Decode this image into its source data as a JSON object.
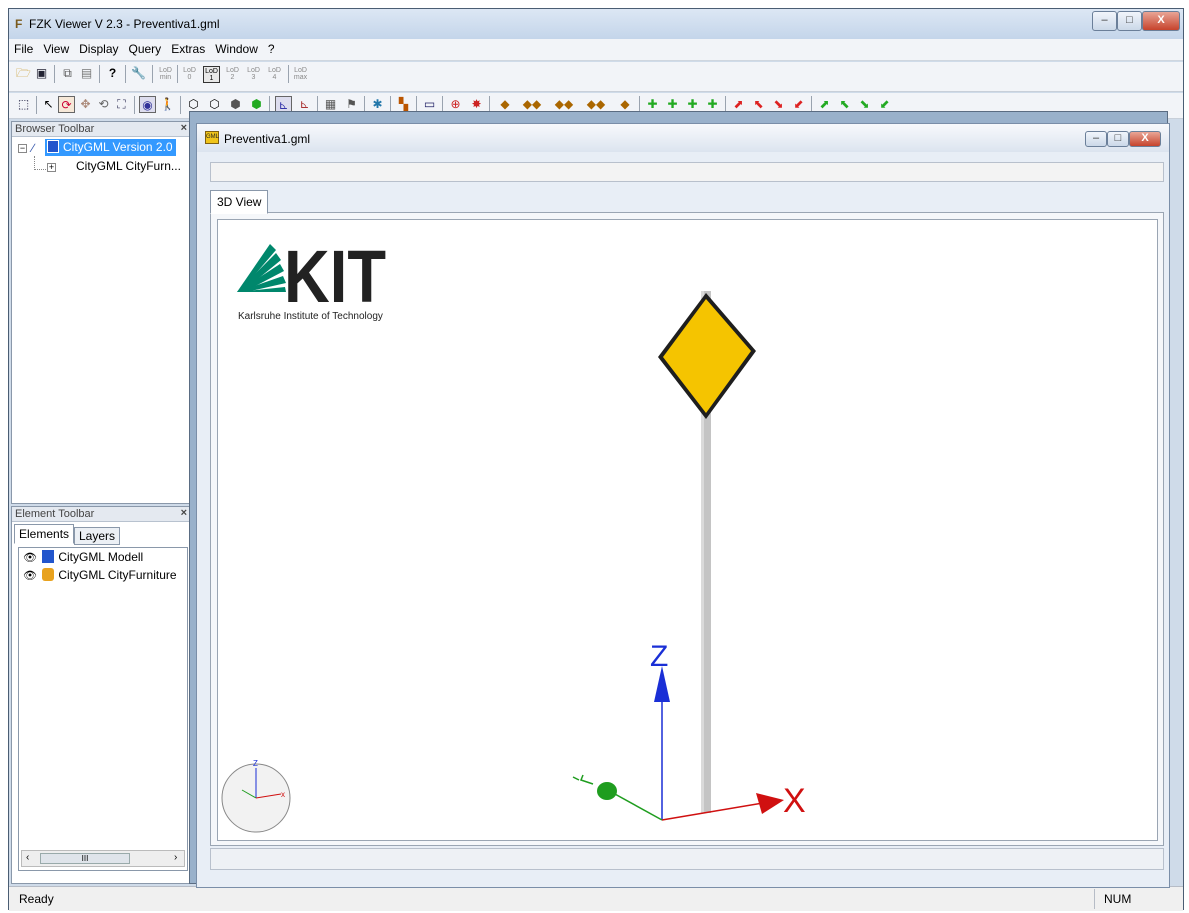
{
  "window": {
    "title": "FZK Viewer V 2.3 - Preventiva1.gml",
    "app_icon": "F"
  },
  "caption_buttons": {
    "minimize": "–",
    "maximize": "□",
    "close": "X"
  },
  "menu": [
    "File",
    "View",
    "Display",
    "Query",
    "Extras",
    "Window",
    "?"
  ],
  "lod_buttons": [
    {
      "top": "LoD",
      "bottom": "min"
    },
    {
      "top": "LoD",
      "bottom": "0"
    },
    {
      "top": "LoD",
      "bottom": "1"
    },
    {
      "top": "LoD",
      "bottom": "2"
    },
    {
      "top": "LoD",
      "bottom": "3"
    },
    {
      "top": "LoD",
      "bottom": "4"
    },
    {
      "top": "LoD",
      "bottom": "max"
    }
  ],
  "browser_toolbar": {
    "title": "Browser Toolbar",
    "close": "×",
    "items": [
      "CityGML Version 2.0",
      "CityGML CityFurn..."
    ]
  },
  "element_toolbar": {
    "title": "Element Toolbar",
    "close": "×",
    "tabs": [
      "Elements",
      "Layers"
    ],
    "items": [
      "CityGML Modell",
      "CityGML CityFurniture"
    ],
    "scroll_thumb": "III"
  },
  "document": {
    "title": "Preventiva1.gml",
    "icon_label": "GML",
    "tab": "3D View"
  },
  "logo": {
    "text": "KIT",
    "subtitle": "Karlsruhe Institute of Technology"
  },
  "axes": {
    "z": "Z",
    "x": "X",
    "mini_z": "Z",
    "mini_x": "x"
  },
  "status": {
    "left": "Ready",
    "right": "NUM"
  },
  "colors": {
    "sign": "#f5c400",
    "axis_x": "#d01010",
    "axis_z": "#1a2fd6",
    "axis_y": "#1f9d1f",
    "logo_green": "#00876c"
  }
}
